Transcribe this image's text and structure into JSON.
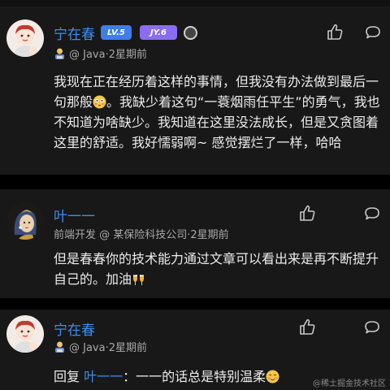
{
  "comments": [
    {
      "author": "宁在春",
      "level_badge": "LV.5",
      "jy_badge": "JY.6",
      "subtitle": "@ Java·2星期前",
      "body": "我现在正在经历着这样的事情，但我没有办法做到最后一句那般",
      "body_2": "。我缺少着这句“一蓑烟雨任平生”的勇气，我也不知道为啥缺少。我知道在这里没法成长，但是又贪图着这里的舒适。我好懦弱啊~ 感觉摆烂了一样，哈哈"
    },
    {
      "author": "叶一一",
      "subtitle": "前端开发 @ 某保险科技公司·2星期前",
      "body": "但是春春你的技术能力通过文章可以看出来是再不断提升自己的。加油"
    },
    {
      "author": "宁在春",
      "subtitle": "@ Java·2星期前",
      "reply_prefix": "回复",
      "reply_to": "叶一一",
      "reply_text": "：一一的话总是特别温柔"
    }
  ],
  "watermark": "@稀土掘金技术社区",
  "icons": [
    "like-icon",
    "comment-icon",
    "worker-emoji-icon",
    "medal-icon",
    "flushed-emoji-icon",
    "clinking-glasses-icon",
    "smiling-blush-emoji-icon"
  ],
  "colors": {
    "link": "#3c8df0",
    "card": "#181818",
    "background": "#000000"
  }
}
